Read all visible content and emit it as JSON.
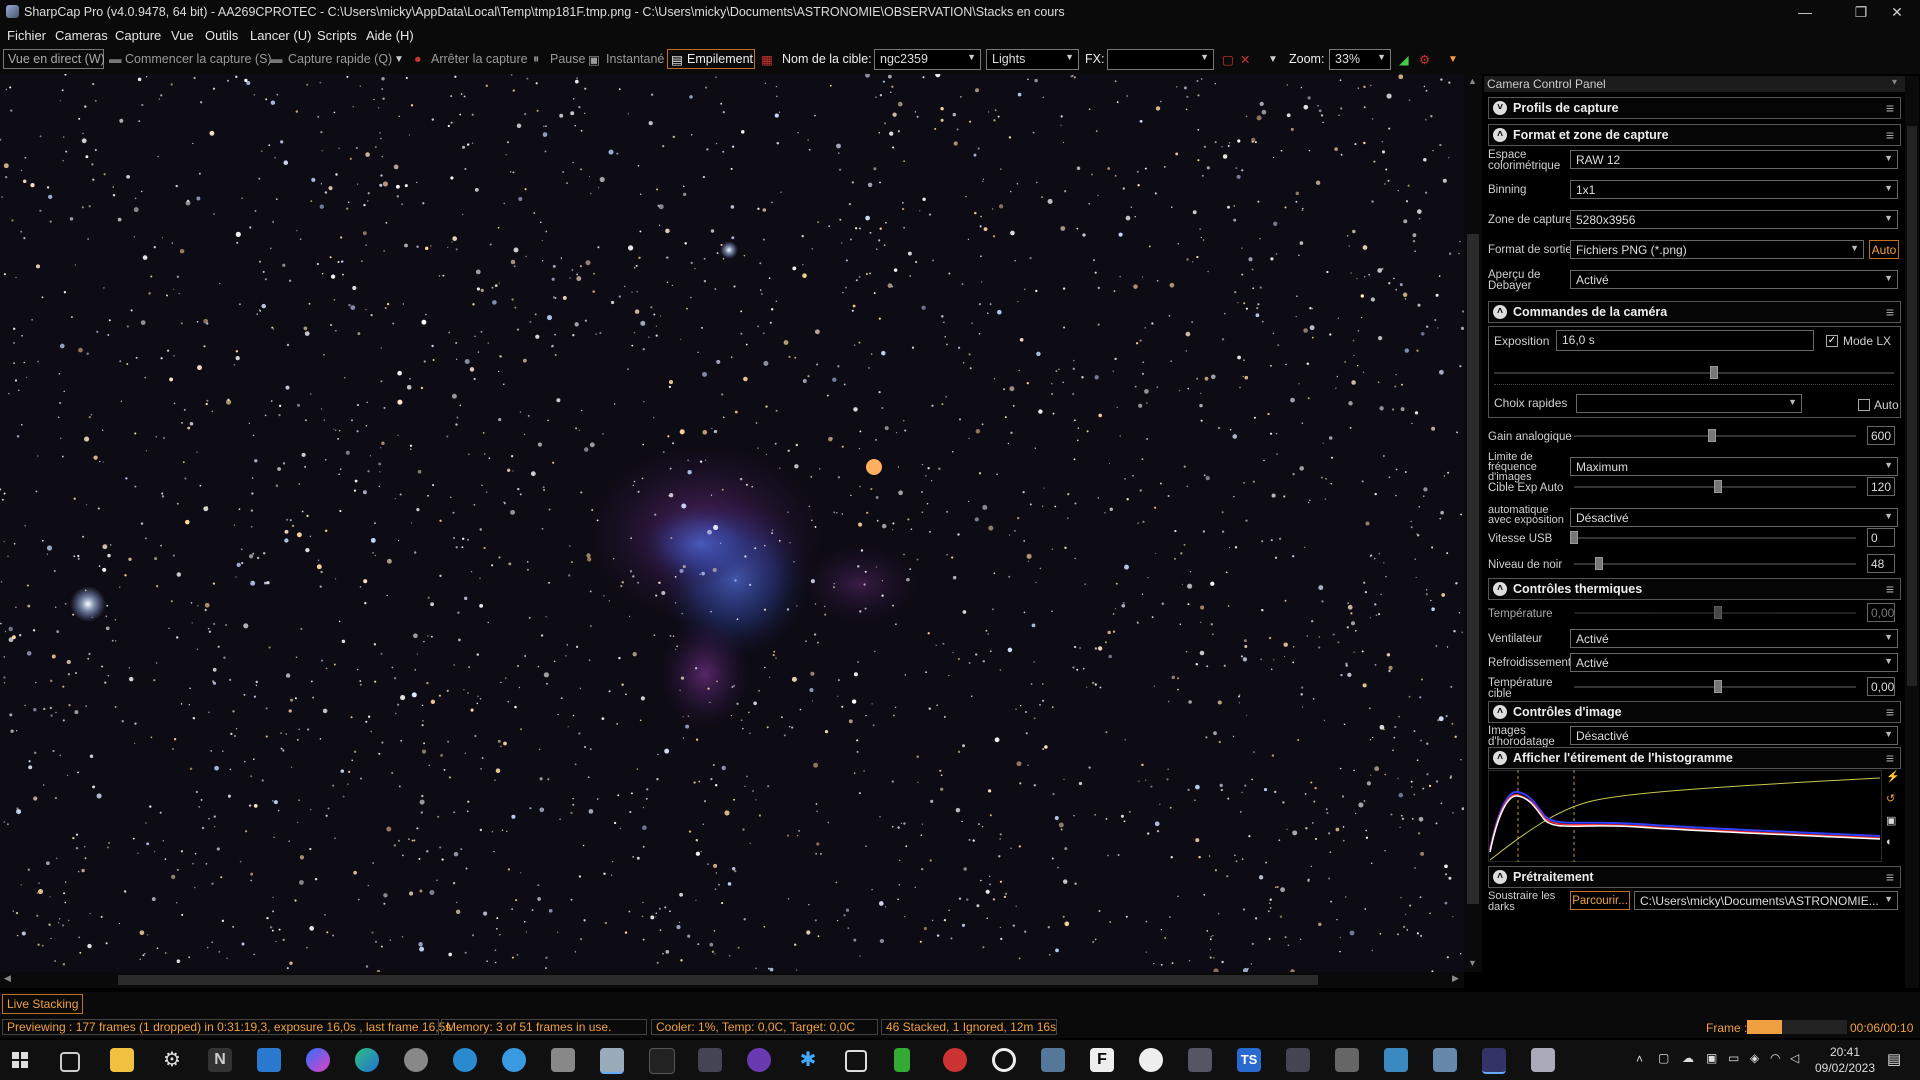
{
  "window": {
    "title": "SharpCap Pro (v4.0.9478, 64 bit) - AA269CPROTEC - C:\\Users\\micky\\AppData\\Local\\Temp\\tmp181F.tmp.png - C:\\Users\\micky\\Documents\\ASTRONOMIE\\OBSERVATION\\Stacks en cours",
    "minimize": "—",
    "maximize": "❐",
    "close": "✕"
  },
  "menu": [
    "Fichier",
    "Cameras",
    "Capture",
    "Vue",
    "Outils",
    "Lancer (U)",
    "Scripts",
    "Aide (H)"
  ],
  "toolbar": {
    "live_view": "Vue en direct (W)",
    "start_capture": "Commencer la capture (S)",
    "quick_capture": "Capture rapide (Q)",
    "stop_capture": "Arrêter la capture",
    "pause": "Pause",
    "snapshot": "Instantané",
    "stacking": "Empilement",
    "target_label": "Nom de la cible:",
    "target_value": "ngc2359",
    "frame_type": "Lights",
    "fx_label": "FX:",
    "fx_value": "",
    "zoom_label": "Zoom:",
    "zoom_value": "33%"
  },
  "panel": {
    "title": "Camera Control Panel",
    "sections": {
      "profiles": "Profils de capture",
      "format": "Format et zone de capture",
      "camera": "Commandes de la caméra",
      "thermal": "Contrôles thermiques",
      "image": "Contrôles d'image",
      "histogram": "Afficher l'étirement de l'histogramme",
      "preprocess": "Prétraitement"
    },
    "format": {
      "colorspace_label": "Espace colorimétrique",
      "colorspace_value": "RAW 12",
      "binning_label": "Binning",
      "binning_value": "1x1",
      "roi_label": "Zone de capture",
      "roi_value": "5280x3956",
      "output_label": "Format de sortie",
      "output_value": "Fichiers PNG (*.png)",
      "output_auto": "Auto",
      "debayer_label": "Aperçu de Debayer",
      "debayer_value": "Activé"
    },
    "camera": {
      "exposure_label": "Exposition",
      "exposure_value": "16,0 s",
      "lx_label": "Mode LX",
      "lx_checked": true,
      "exposure_slider": 0.55,
      "quick_label": "Choix rapides",
      "quick_value": "",
      "quick_auto": "Auto",
      "gain_label": "Gain analogique",
      "gain_value": "600",
      "gain_slider": 0.49,
      "framerate_label": "Limite de fréquence d'images",
      "framerate_value": "Maximum",
      "autoexp_label": "Cible Exp Auto",
      "autoexp_value": "120",
      "autoexp_slider": 0.51,
      "autoexp_mode_label": "automatique avec exposition",
      "autoexp_mode_value": "Désactivé",
      "usb_label": "Vitesse USB",
      "usb_value": "0",
      "usb_slider": 0.0,
      "black_label": "Niveau de noir",
      "black_value": "48",
      "black_slider": 0.09
    },
    "thermal": {
      "temp_label": "Température",
      "temp_value": "0,00",
      "temp_slider": 0.51,
      "fan_label": "Ventilateur",
      "fan_value": "Activé",
      "cooling_label": "Refroidissement",
      "cooling_value": "Activé",
      "target_label": "Température cible",
      "target_value": "0,00",
      "target_slider": 0.51
    },
    "image": {
      "timestamp_label": "Images d'horodatage",
      "timestamp_value": "Désactivé"
    },
    "preprocess": {
      "darks_label": "Soustraire les darks",
      "browse": "Parcourir...",
      "path": "C:\\Users\\micky\\Documents\\ASTRONOMIE..."
    }
  },
  "live_stacking_tab": "Live Stacking",
  "status": {
    "preview": "Previewing : 177 frames (1 dropped) in 0:31:19,3, exposure 16,0s , last frame 16,5s",
    "memory": "Memory: 3 of 51 frames in use.",
    "cooler": "Cooler: 1%, Temp: 0,0C, Target: 0,0C",
    "stack": "46 Stacked, 1 Ignored, 12m 16s",
    "frame_label": "Frame :",
    "frame_progress": 0.35,
    "frame_time": "00:06/00:10"
  },
  "taskbar": {
    "time": "20:41",
    "date": "09/02/2023"
  },
  "colors": {
    "accent": "#f0a040",
    "background": "#000000",
    "nebula": "#3050b0"
  }
}
